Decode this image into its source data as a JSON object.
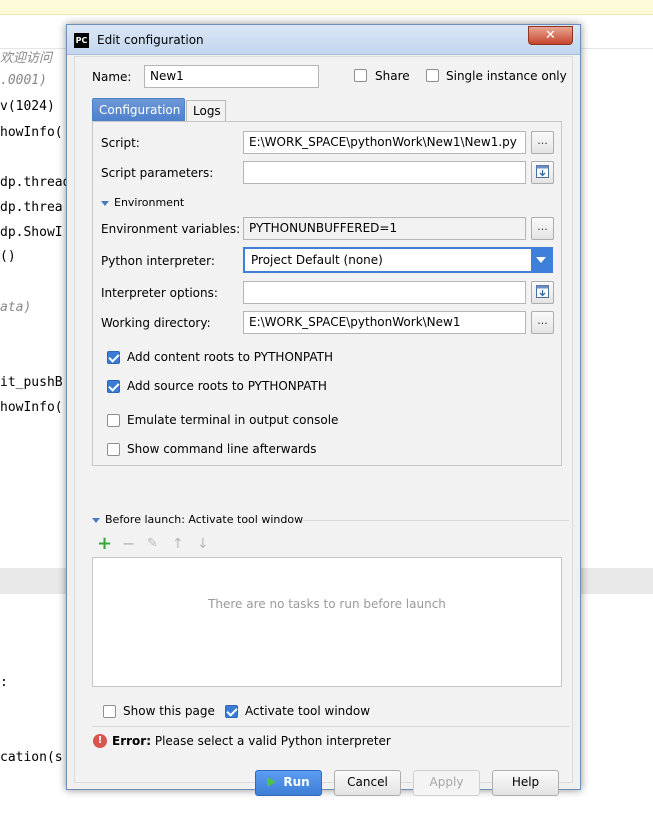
{
  "background": {
    "code_lines": [
      {
        "text": "欢迎访问",
        "style": "italic"
      },
      {
        "text": ".0001)",
        "style": "italic"
      },
      {
        "text": "v(1024)",
        "style": "kw"
      },
      {
        "text": "howInfo(",
        "style": "kw"
      },
      {
        "text": "dp.thread",
        "style": "kw"
      },
      {
        "text": "dp.threa",
        "style": "kw"
      },
      {
        "text": "dp.ShowI",
        "style": "kw"
      },
      {
        "text": "()",
        "style": "kw"
      },
      {
        "text": "ata)",
        "style": "italic"
      },
      {
        "text": "it_pushB",
        "style": "kw"
      },
      {
        "text": "howInfo(",
        "style": "kw"
      },
      {
        "text": ":",
        "style": "kw"
      },
      {
        "text": "cation(s",
        "style": "kw"
      }
    ]
  },
  "dialog": {
    "title": "Edit configuration",
    "app_icon_text": "PC",
    "close_glyph": "✕",
    "name_label": "Name:",
    "name_value": "New1",
    "share_label": "Share",
    "share_checked": false,
    "single_instance_label": "Single instance only",
    "single_instance_checked": false,
    "tabs": [
      {
        "label": "Configuration",
        "active": true
      },
      {
        "label": "Logs",
        "active": false
      }
    ],
    "script_label": "Script:",
    "script_value": "E:\\WORK_SPACE\\pythonWork\\New1\\New1.py",
    "script_params_label": "Script parameters:",
    "script_params_value": "",
    "environment_label": "Environment",
    "env_vars_label": "Environment variables:",
    "env_vars_value": "PYTHONUNBUFFERED=1",
    "interpreter_label": "Python interpreter:",
    "interpreter_value": "Project Default (none)",
    "interp_options_label": "Interpreter options:",
    "interp_options_value": "",
    "working_dir_label": "Working directory:",
    "working_dir_value": "E:\\WORK_SPACE\\pythonWork\\New1",
    "ellipsis": "...",
    "checkboxes": [
      {
        "label": "Add content roots to PYTHONPATH",
        "checked": true
      },
      {
        "label": "Add source roots to PYTHONPATH",
        "checked": true
      },
      {
        "label": "Emulate terminal in output console",
        "checked": false
      },
      {
        "label": "Show command line afterwards",
        "checked": false
      }
    ],
    "before_launch_label": "Before launch: Activate tool window",
    "toolbar_glyphs": {
      "add": "+",
      "remove": "−",
      "edit": "✎",
      "up": "↑",
      "down": "↓"
    },
    "empty_tasks_text": "There are no tasks to run before launch",
    "show_page_label": "Show this page",
    "show_page_checked": false,
    "activate_tool_label": "Activate tool window",
    "activate_tool_checked": true,
    "error_prefix": "Error:",
    "error_message": "Please select a valid Python interpreter",
    "error_glyph": "!",
    "buttons": {
      "run": "Run",
      "cancel": "Cancel",
      "apply": "Apply",
      "help": "Help"
    },
    "colors": {
      "accent": "#3d7fd9",
      "error": "#d9534f",
      "run_icon": "#4ec24a"
    }
  }
}
